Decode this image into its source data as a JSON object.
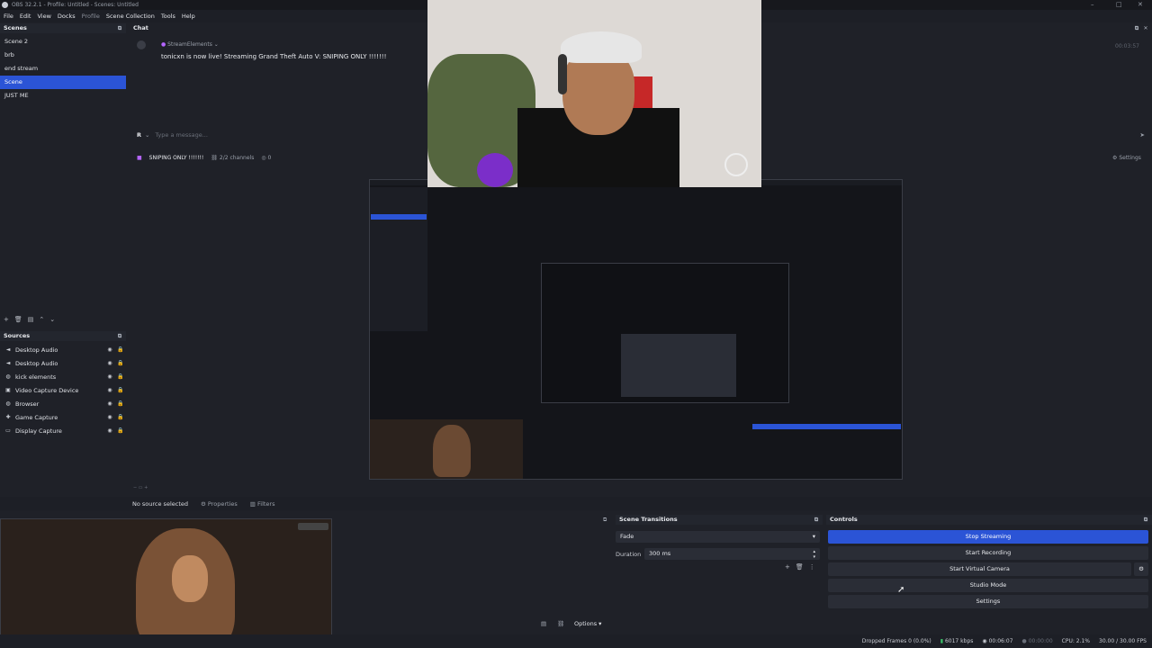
{
  "window": {
    "title": "OBS 32.2.1 - Profile: Untitled - Scenes: Untitled",
    "controls": [
      "–",
      "□",
      "✕"
    ]
  },
  "menu": [
    "File",
    "Edit",
    "View",
    "Docks",
    "Profile",
    "Scene Collection",
    "Tools",
    "Help"
  ],
  "scenes": {
    "title": "Scenes",
    "items": [
      "Scene 2",
      "brb",
      "end stream",
      "Scene",
      "JUST ME"
    ],
    "selected": "Scene"
  },
  "sources": {
    "title": "Sources",
    "items": [
      {
        "label": "Desktop Audio",
        "icon": "speaker-icon"
      },
      {
        "label": "Desktop Audio",
        "icon": "speaker-icon"
      },
      {
        "label": "kick elements",
        "icon": "globe-icon"
      },
      {
        "label": "Video Capture Device",
        "icon": "camera-icon"
      },
      {
        "label": "Browser",
        "icon": "globe-icon"
      },
      {
        "label": "Game Capture",
        "icon": "gamepad-icon"
      },
      {
        "label": "Display Capture",
        "icon": "monitor-icon"
      }
    ]
  },
  "chat": {
    "title": "Chat",
    "sender": "StreamElements",
    "message": "tonicxn is now live! Streaming Grand Theft Auto V: SNIPING ONLY !!!!!!!",
    "time": "00:03:57",
    "input_placeholder": "Type a message...",
    "channel_title": "SNIPING ONLY !!!!!!!",
    "channels": "2/2 channels",
    "viewers": "0",
    "settings_label": "Settings"
  },
  "preview": {
    "no_source": "No source selected",
    "properties_label": "Properties",
    "filters_label": "Filters"
  },
  "transitions": {
    "title": "Scene Transitions",
    "selected": "Fade",
    "duration_label": "Duration",
    "duration_value": "300 ms"
  },
  "audio_mixer": {
    "options_label": "Options"
  },
  "controls": {
    "title": "Controls",
    "buttons": [
      "Stop Streaming",
      "Start Recording",
      "Start Virtual Camera",
      "Studio Mode",
      "Settings"
    ],
    "active": "Stop Streaming"
  },
  "status": {
    "dropped_frames": "Dropped Frames 0 (0.0%)",
    "bitrate": "6017 kbps",
    "live_time": "00:06:07",
    "rec_time": "00:00:00",
    "cpu": "CPU: 2.1%",
    "fps": "30.00 / 30.00 FPS"
  },
  "colors": {
    "accent": "#2b54d6",
    "panel": "#1f2128",
    "header": "#23262e"
  }
}
